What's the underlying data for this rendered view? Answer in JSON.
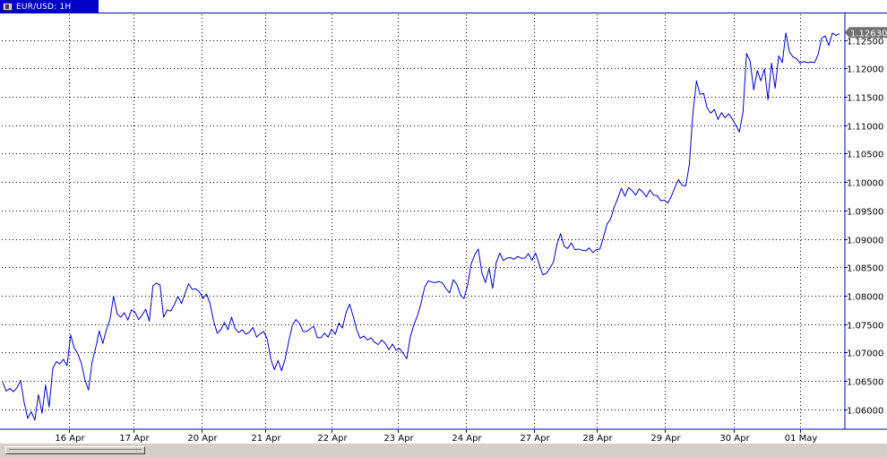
{
  "window": {
    "tab_label": "EUR/USD: 1H"
  },
  "colors": {
    "line": "#0000c8",
    "grid": "#000000",
    "axis": "#0000c8",
    "price_tag_bg": "#707070",
    "price_tag_text": "#ffffff"
  },
  "chart_data": {
    "type": "line",
    "title": "",
    "xlabel": "",
    "ylabel": "",
    "ylim": [
      1.0565,
      1.1295
    ],
    "y_ticks": [
      "1.12500",
      "1.12000",
      "1.11500",
      "1.11000",
      "1.10500",
      "1.10000",
      "1.09500",
      "1.09000",
      "1.08500",
      "1.08000",
      "1.07500",
      "1.07000",
      "1.06500",
      "1.06000"
    ],
    "x_ticks": [
      "16 Apr",
      "17 Apr",
      "20 Apr",
      "21 Apr",
      "22 Apr",
      "23 Apr",
      "24 Apr",
      "27 Apr",
      "28 Apr",
      "29 Apr",
      "30 Apr",
      "01 May"
    ],
    "grid": true,
    "last_price_label": "1.12630",
    "series": [
      {
        "values": [
          1.0648,
          1.0632,
          1.0637,
          1.0631,
          1.0638,
          1.0651,
          1.0612,
          1.0584,
          1.0596,
          1.0581,
          1.0626,
          1.0593,
          1.0643,
          1.0604,
          1.0672,
          1.0684,
          1.068,
          1.0688,
          1.0677,
          1.0731,
          1.0708,
          1.0698,
          1.0681,
          1.0652,
          1.0634,
          1.0683,
          1.0708,
          1.0738,
          1.0716,
          1.074,
          1.0758,
          1.0799,
          1.0768,
          1.0762,
          1.077,
          1.0757,
          1.0775,
          1.0771,
          1.0758,
          1.0766,
          1.0776,
          1.0755,
          1.0817,
          1.0822,
          1.0819,
          1.0762,
          1.0775,
          1.0773,
          1.0784,
          1.0799,
          1.0786,
          1.0804,
          1.0821,
          1.0811,
          1.0812,
          1.0807,
          1.0795,
          1.0803,
          1.0786,
          1.0755,
          1.0734,
          1.074,
          1.0753,
          1.074,
          1.0762,
          1.0742,
          1.0735,
          1.074,
          1.0732,
          1.0736,
          1.0744,
          1.0727,
          1.0733,
          1.0737,
          1.0723,
          1.0688,
          1.067,
          1.0686,
          1.0668,
          1.0689,
          1.072,
          1.0748,
          1.0758,
          1.0751,
          1.0737,
          1.0737,
          1.0742,
          1.0746,
          1.0726,
          1.0726,
          1.0734,
          1.0727,
          1.0741,
          1.0732,
          1.0752,
          1.0743,
          1.077,
          1.0785,
          1.0764,
          1.074,
          1.0725,
          1.0729,
          1.0722,
          1.0726,
          1.0718,
          1.0714,
          1.0722,
          1.0716,
          1.0705,
          1.0715,
          1.0704,
          1.0707,
          1.0698,
          1.0689,
          1.0728,
          1.0749,
          1.0765,
          1.0787,
          1.0815,
          1.0826,
          1.0824,
          1.0823,
          1.0825,
          1.0822,
          1.0812,
          1.0805,
          1.0828,
          1.082,
          1.0801,
          1.0795,
          1.0818,
          1.0856,
          1.0872,
          1.0882,
          1.084,
          1.0823,
          1.0848,
          1.0813,
          1.0858,
          1.0875,
          1.0862,
          1.0866,
          1.0867,
          1.0864,
          1.0869,
          1.0866,
          1.0866,
          1.0874,
          1.0862,
          1.0875,
          1.0856,
          1.0837,
          1.0839,
          1.0848,
          1.0859,
          1.0891,
          1.0909,
          1.0887,
          1.0883,
          1.0893,
          1.0881,
          1.0882,
          1.088,
          1.0879,
          1.0884,
          1.0876,
          1.0881,
          1.0882,
          1.0903,
          1.0926,
          1.0935,
          1.0956,
          1.0971,
          1.0989,
          1.0975,
          1.099,
          1.0985,
          1.0977,
          1.0988,
          1.0982,
          1.0974,
          1.0986,
          1.0977,
          1.0976,
          1.0967,
          1.0968,
          1.0963,
          1.0975,
          1.0991,
          1.1004,
          1.0994,
          1.0993,
          1.103,
          1.112,
          1.1178,
          1.1154,
          1.1156,
          1.113,
          1.1121,
          1.1128,
          1.111,
          1.1122,
          1.1113,
          1.112,
          1.1111,
          1.11,
          1.1088,
          1.1122,
          1.1226,
          1.1213,
          1.1162,
          1.1196,
          1.1178,
          1.1199,
          1.1145,
          1.1209,
          1.1165,
          1.1222,
          1.121,
          1.1262,
          1.1229,
          1.122,
          1.1217,
          1.1209,
          1.1212,
          1.121,
          1.1211,
          1.121,
          1.1224,
          1.1253,
          1.1257,
          1.124,
          1.1262,
          1.1258,
          1.1261
        ]
      }
    ]
  }
}
